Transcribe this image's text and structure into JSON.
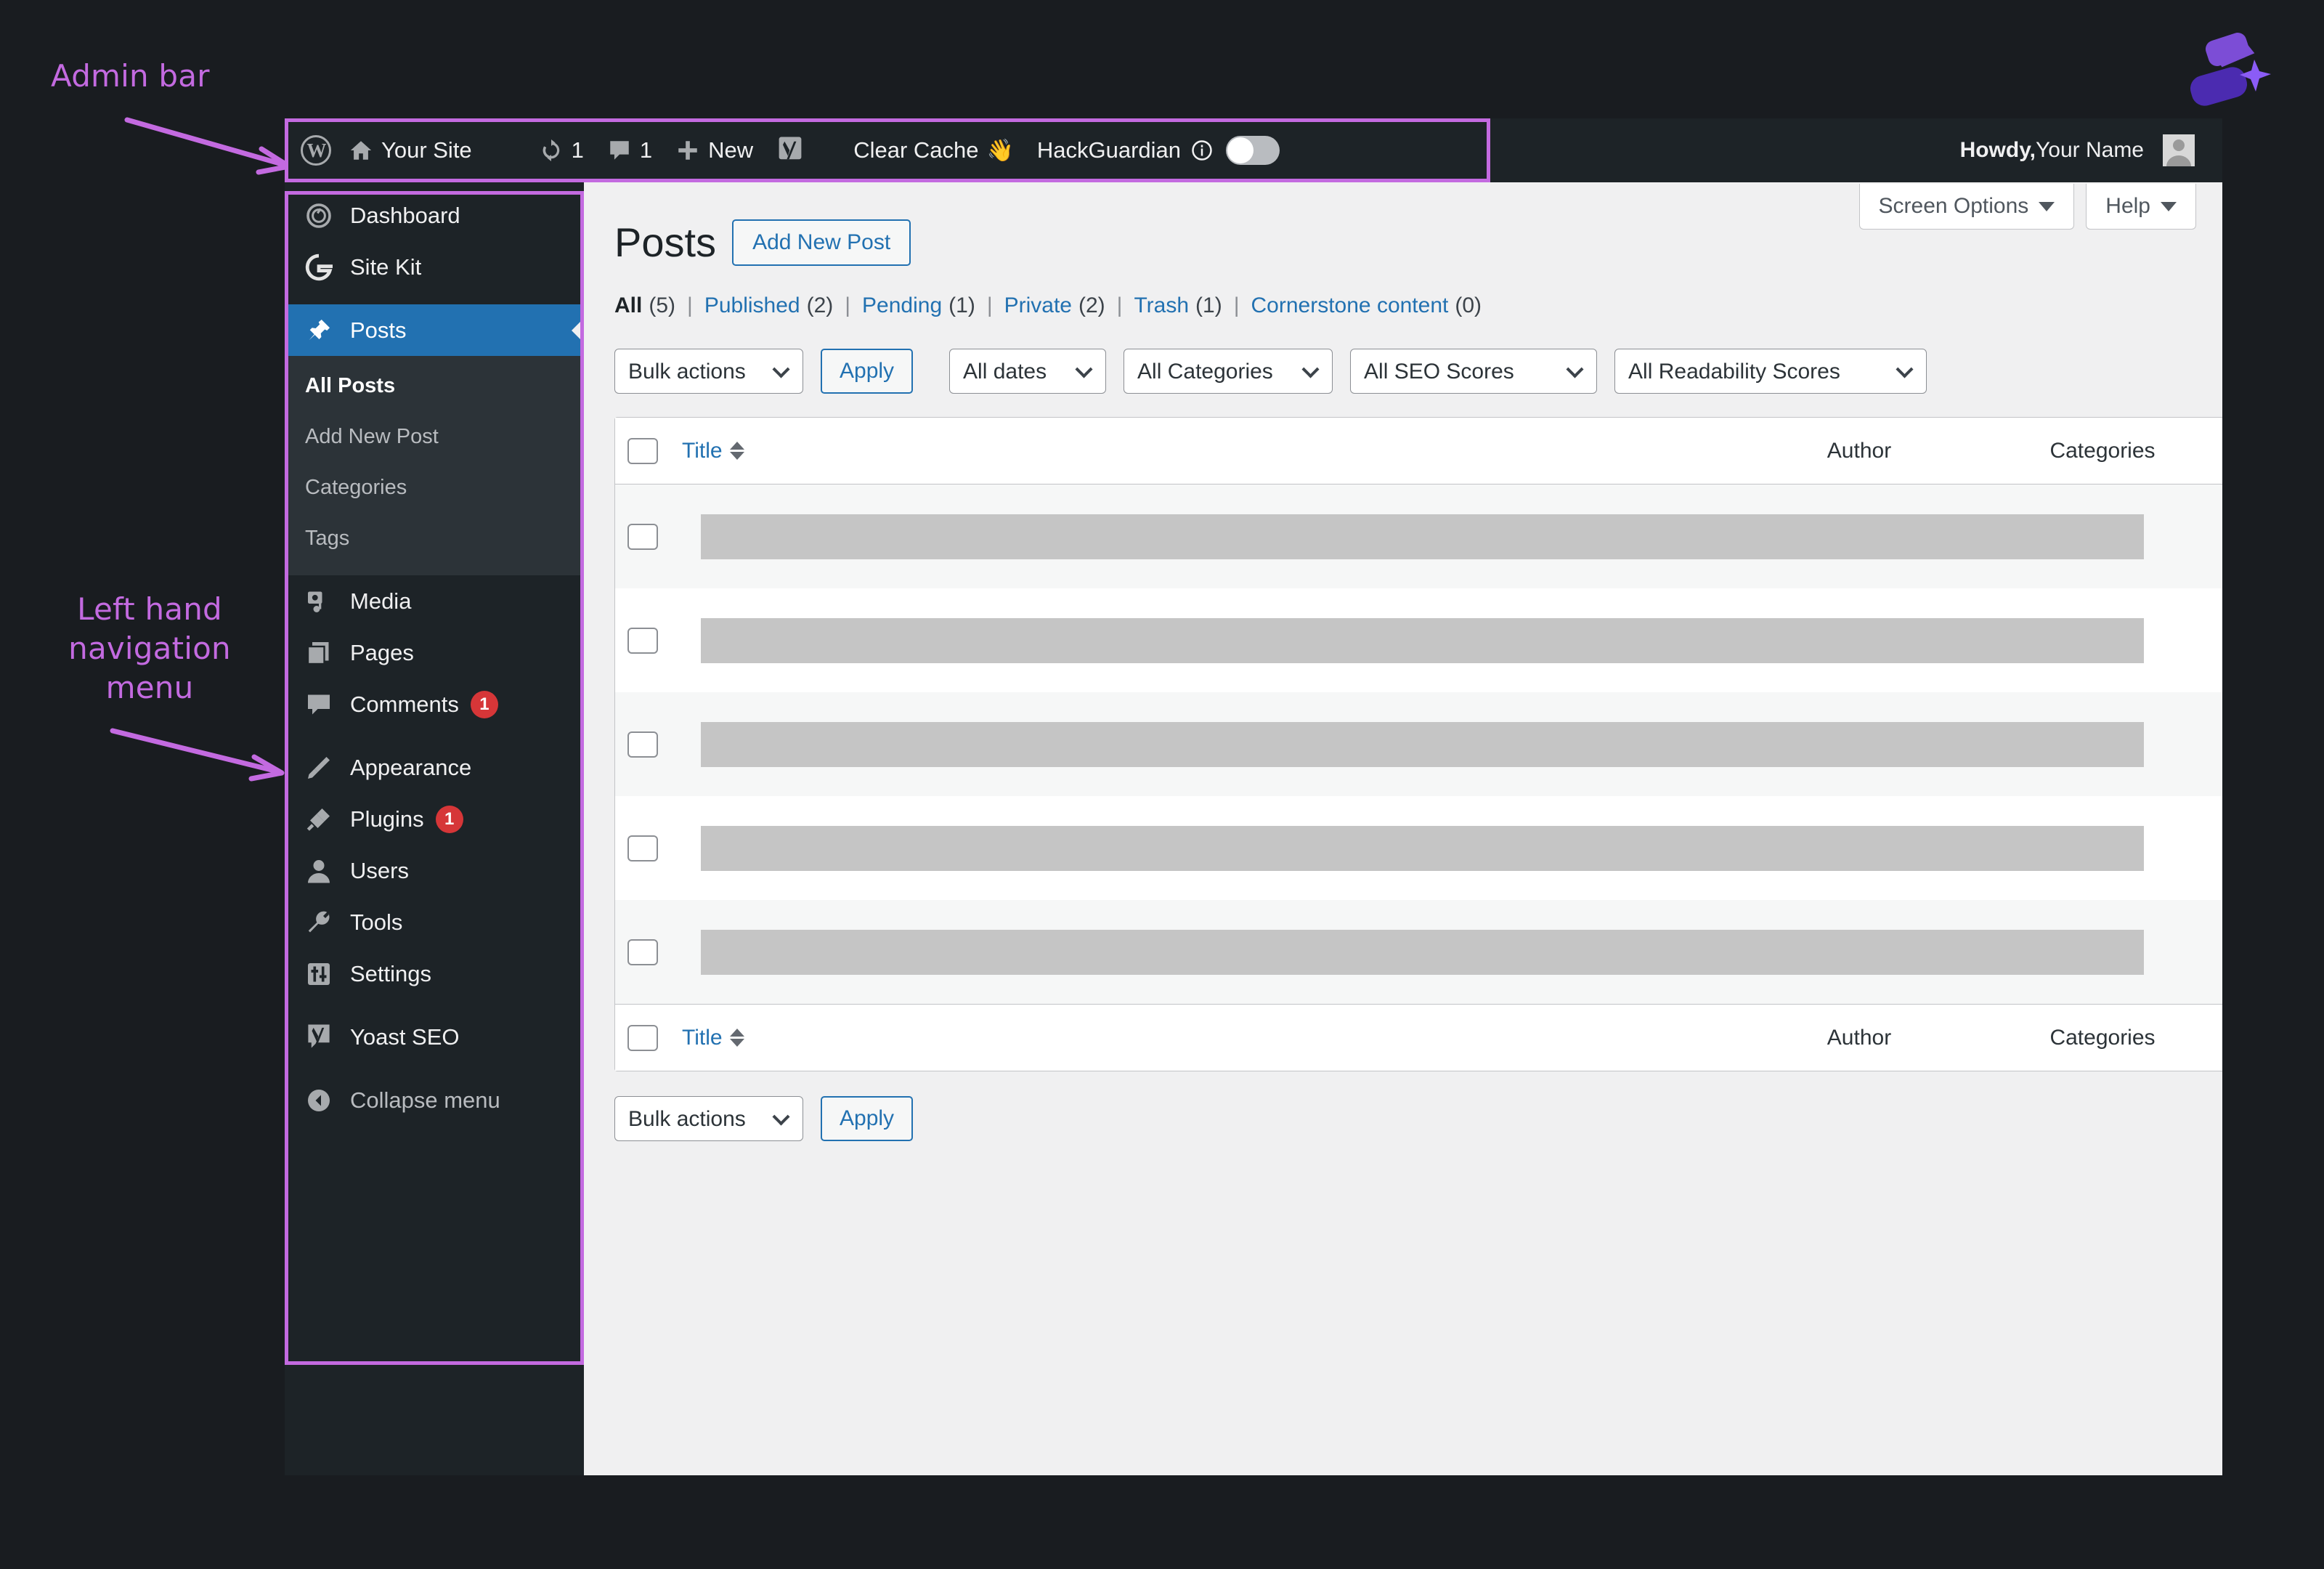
{
  "annotations": {
    "admin_bar_label": "Admin bar",
    "left_nav_label": "Left hand\nnavigation\nmenu",
    "accent_color": "#c36ae0"
  },
  "brand": {
    "name": "brand-logo"
  },
  "admin_bar": {
    "wp_logo": "W",
    "site_name": "Your Site",
    "updates_count": "1",
    "comments_count": "1",
    "new_label": "New",
    "yoast_label": "Y",
    "clear_cache_label": "Clear Cache",
    "clear_cache_emoji": "👋",
    "hackguardian_label": "HackGuardian",
    "howdy_prefix": "Howdy,",
    "user_name": "Your Name"
  },
  "sidebar": {
    "items": [
      {
        "label": "Dashboard",
        "icon": "dashboard-icon",
        "badge": null,
        "current": false
      },
      {
        "label": "Site Kit",
        "icon": "google-g-icon",
        "badge": null,
        "current": false
      },
      {
        "label": "Posts",
        "icon": "pin-icon",
        "badge": null,
        "current": true
      },
      {
        "label": "Media",
        "icon": "media-icon",
        "badge": null,
        "current": false
      },
      {
        "label": "Pages",
        "icon": "pages-icon",
        "badge": null,
        "current": false
      },
      {
        "label": "Comments",
        "icon": "comment-icon",
        "badge": "1",
        "current": false
      },
      {
        "label": "Appearance",
        "icon": "brush-icon",
        "badge": null,
        "current": false
      },
      {
        "label": "Plugins",
        "icon": "plug-icon",
        "badge": "1",
        "current": false
      },
      {
        "label": "Users",
        "icon": "user-icon",
        "badge": null,
        "current": false
      },
      {
        "label": "Tools",
        "icon": "wrench-icon",
        "badge": null,
        "current": false
      },
      {
        "label": "Settings",
        "icon": "sliders-icon",
        "badge": null,
        "current": false
      },
      {
        "label": "Yoast SEO",
        "icon": "yoast-icon",
        "badge": null,
        "current": false
      }
    ],
    "submenu": [
      {
        "label": "All Posts",
        "current": true
      },
      {
        "label": "Add New Post",
        "current": false
      },
      {
        "label": "Categories",
        "current": false
      },
      {
        "label": "Tags",
        "current": false
      }
    ],
    "collapse_label": "Collapse menu"
  },
  "screen_meta": {
    "screen_options": "Screen Options",
    "help": "Help"
  },
  "page": {
    "title": "Posts",
    "add_new_button": "Add New Post"
  },
  "status_links": [
    {
      "label": "All",
      "count": "(5)",
      "current": true
    },
    {
      "label": "Published",
      "count": "(2)",
      "current": false
    },
    {
      "label": "Pending",
      "count": "(1)",
      "current": false
    },
    {
      "label": "Private",
      "count": "(2)",
      "current": false
    },
    {
      "label": "Trash",
      "count": "(1)",
      "current": false
    },
    {
      "label": "Cornerstone content",
      "count": "(0)",
      "current": false
    }
  ],
  "toolbar": {
    "bulk_actions_value": "Bulk actions",
    "apply_label": "Apply",
    "all_dates_value": "All dates",
    "all_categories_value": "All Categories",
    "all_seo_scores_value": "All SEO Scores",
    "all_readability_value": "All Readability Scores"
  },
  "table": {
    "columns": {
      "title": "Title",
      "author": "Author",
      "categories": "Categories"
    },
    "rows": [
      {
        "redacted": true,
        "redact_width": 1987,
        "shade": "alt"
      },
      {
        "redacted": true,
        "redact_width": 1987,
        "shade": "white"
      },
      {
        "redacted": true,
        "redact_width": 1987,
        "shade": "alt"
      },
      {
        "redacted": true,
        "redact_width": 1987,
        "shade": "white"
      },
      {
        "redacted": true,
        "redact_width": 1987,
        "shade": "alt"
      }
    ]
  },
  "toolbar_bottom": {
    "bulk_actions_value": "Bulk actions",
    "apply_label": "Apply"
  }
}
